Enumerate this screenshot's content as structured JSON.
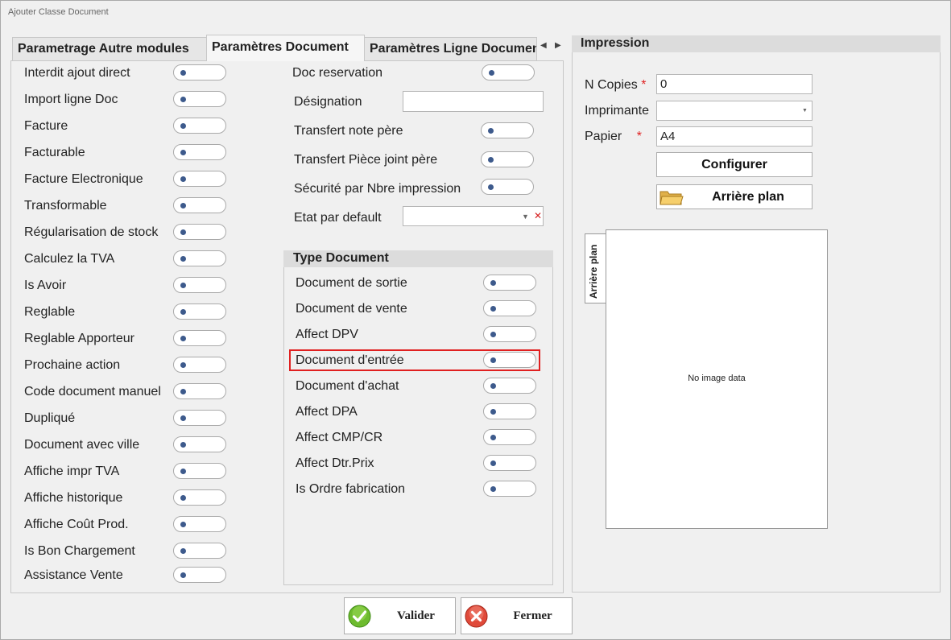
{
  "window": {
    "title": "Ajouter Classe Document"
  },
  "tabs": [
    {
      "label": "Parametrage Autre modules"
    },
    {
      "label": "Paramètres Document"
    },
    {
      "label": "Paramètres Ligne Document"
    }
  ],
  "left_toggles": [
    {
      "label": "Interdit ajout direct",
      "value": false
    },
    {
      "label": "Import ligne Doc",
      "value": false
    },
    {
      "label": "Facture",
      "value": false
    },
    {
      "label": "Facturable",
      "value": false
    },
    {
      "label": "Facture Electronique",
      "value": false
    },
    {
      "label": "Transformable",
      "value": false
    },
    {
      "label": "Régularisation de stock",
      "value": false
    },
    {
      "label": "Calculez la TVA",
      "value": false
    },
    {
      "label": "Is Avoir",
      "value": false
    },
    {
      "label": "Reglable",
      "value": false
    },
    {
      "label": "Reglable Apporteur",
      "value": false
    },
    {
      "label": "Prochaine action",
      "value": false
    },
    {
      "label": "Code document manuel",
      "value": false
    },
    {
      "label": "Dupliqué",
      "value": false
    },
    {
      "label": "Document avec ville",
      "value": false
    },
    {
      "label": "Affiche impr TVA",
      "value": false
    },
    {
      "label": "Affiche historique",
      "value": false
    },
    {
      "label": "Affiche Coût Prod.",
      "value": false
    },
    {
      "label": "Is Bon Chargement",
      "value": false
    },
    {
      "label": "Assistance Vente",
      "value": false
    }
  ],
  "middle": {
    "doc_reservation": "Doc reservation",
    "designation_label": "Désignation",
    "designation_value": "",
    "transfert_note": "Transfert note père",
    "transfert_piece": "Transfert Pièce joint père",
    "securite": "Sécurité par Nbre impression",
    "etat_label": "Etat par default",
    "etat_value": ""
  },
  "type_document": {
    "title": "Type Document",
    "items": [
      {
        "label": "Document de sortie",
        "value": false
      },
      {
        "label": "Document de vente",
        "value": false
      },
      {
        "label": "Affect DPV",
        "value": false
      },
      {
        "label": "Document d'entrée",
        "value": false
      },
      {
        "label": "Document d'achat",
        "value": false
      },
      {
        "label": "Affect DPA",
        "value": false
      },
      {
        "label": "Affect CMP/CR",
        "value": false
      },
      {
        "label": "Affect Dtr.Prix",
        "value": false
      },
      {
        "label": "Is Ordre fabrication",
        "value": false
      }
    ]
  },
  "impression": {
    "title": "Impression",
    "copies_label": "N Copies",
    "copies_value": "0",
    "imprimante_label": "Imprimante",
    "imprimante_value": "",
    "papier_label": "Papier",
    "papier_value": "A4",
    "required_mark": "*",
    "configurer": "Configurer",
    "arriere_plan_button": "Arrière plan",
    "arriere_plan_tab": "Arrière plan",
    "no_image": "No image data"
  },
  "footer": {
    "valider": "Valider",
    "fermer": "Fermer"
  },
  "colors": {
    "accent_highlight": "#e02020",
    "toggle_knob": "#3d5a8c"
  },
  "icons": {
    "valider": "check-circle-icon",
    "fermer": "x-circle-icon",
    "arriere_plan": "folder-icon"
  }
}
